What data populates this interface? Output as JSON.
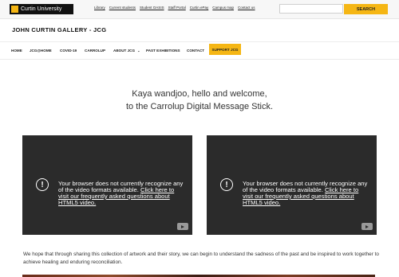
{
  "header": {
    "logo_text": "Curtin University",
    "top_links": [
      "Library",
      "Current students",
      "Student OASIS",
      "Staff Portal",
      "Curtin ePay",
      "Campus map",
      "Contact us"
    ],
    "search": {
      "placeholder": "",
      "button_label": "SEARCH"
    },
    "brand_color": "#f5b614"
  },
  "site": {
    "title": "JOHN CURTIN GALLERY - JCG"
  },
  "nav": {
    "items": [
      "HOME",
      "JCG@HOME",
      "COVID-19",
      "CARROLUP",
      "ABOUT JCG",
      "PAST EXHIBITIONS",
      "CONTACT"
    ],
    "about_has_dropdown": true,
    "support_label": "SUPPORT JCG"
  },
  "main": {
    "welcome_line1": "Kaya wandjoo, hello and welcome,",
    "welcome_line2": "to the Carrolup Digital Message Stick.",
    "videos": [
      {
        "message": "Your browser does not currently recognize any of the video formats available.",
        "link_text": "Click here to visit our frequently asked questions about HTML5 video."
      },
      {
        "message": "Your browser does not currently recognize any of the video formats available.",
        "link_text": "Click here to visit our frequently asked questions about HTML5 video."
      }
    ],
    "paragraph": "We hope that through sharing this collection of artwork and their story, we can begin to understand the sadness of the past and be inspired to work together to achieve healing and enduring reconciliation."
  }
}
